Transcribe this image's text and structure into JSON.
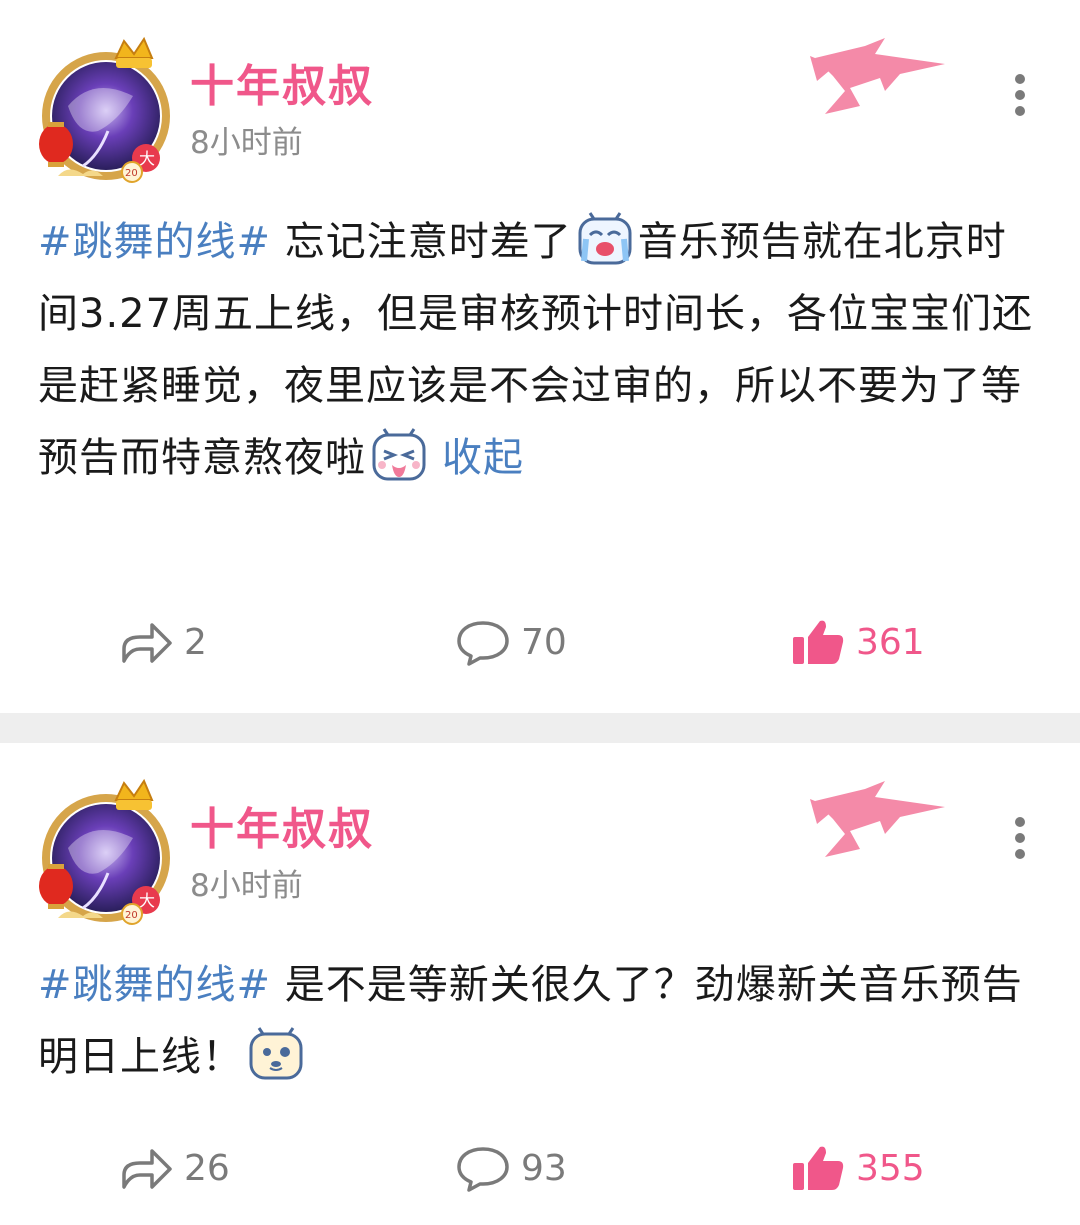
{
  "posts": [
    {
      "username": "十年叔叔",
      "time": "8小时前",
      "hashtag": "#跳舞的线#",
      "text_parts": [
        "忘记注意时差了",
        "音乐预告就在北京时间3.27周五上线，但是审核预计时间长，各位宝宝们还是赶紧睡觉，夜里应该是不会过审的，所以不要为了等预告而特意熬夜啦"
      ],
      "emojis": [
        "crying-emoji",
        "tongue-emoji"
      ],
      "collapse_label": "收起",
      "shares": "2",
      "comments": "70",
      "likes": "361"
    },
    {
      "username": "十年叔叔",
      "time": "8小时前",
      "hashtag": "#跳舞的线#",
      "text_parts": [
        "是不是等新关很久了？劲爆新关音乐预告明日上线！"
      ],
      "emojis": [
        "dog-emoji"
      ],
      "shares": "26",
      "comments": "93",
      "likes": "355"
    }
  ],
  "colors": {
    "username": "#f0578a",
    "hashtag": "#4a7fc0",
    "like": "#f0578a",
    "muted": "#8c8c8c",
    "divider": "#eeeeee"
  },
  "icons": [
    "avatar-frame",
    "lantern-icon",
    "crown-icon",
    "vip-badge-icon",
    "more-icon",
    "share-icon",
    "comment-icon",
    "like-icon"
  ]
}
